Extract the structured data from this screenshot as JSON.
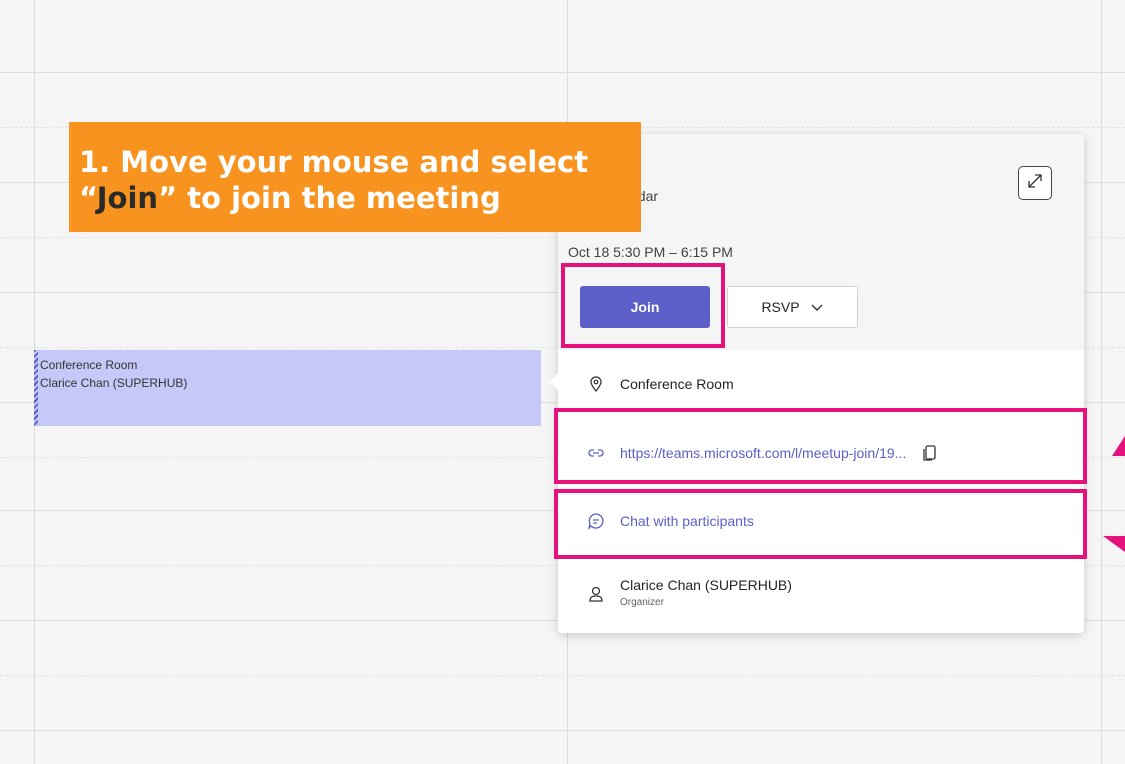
{
  "banner": {
    "line1": "1. Move your mouse and select",
    "line2_quote_open": "“",
    "line2_join": "Join",
    "line2_rest": "” to join the meeting"
  },
  "event": {
    "location": "Conference Room",
    "organizer": "Clarice Chan (SUPERHUB)"
  },
  "popup": {
    "calendar_label": "ndar",
    "time": "Oct 18 5:30 PM – 6:15 PM",
    "join_label": "Join",
    "rsvp_label": "RSVP",
    "location": "Conference Room",
    "meeting_link": "https://teams.microsoft.com/l/meetup-join/19...",
    "chat_label": "Chat with participants",
    "organizer_name": "Clarice Chan (SUPERHUB)",
    "organizer_role": "Organizer"
  },
  "icons": {
    "expand": "expand-icon",
    "location": "location-pin-icon",
    "link": "link-icon",
    "copy": "copy-icon",
    "chat": "chat-icon",
    "person": "person-icon",
    "chevron": "chevron-down-icon"
  },
  "colors": {
    "accent": "#5b5fc7",
    "event_fill": "#c5c9f7",
    "highlight": "#e5127d",
    "banner": "#f7931e"
  }
}
